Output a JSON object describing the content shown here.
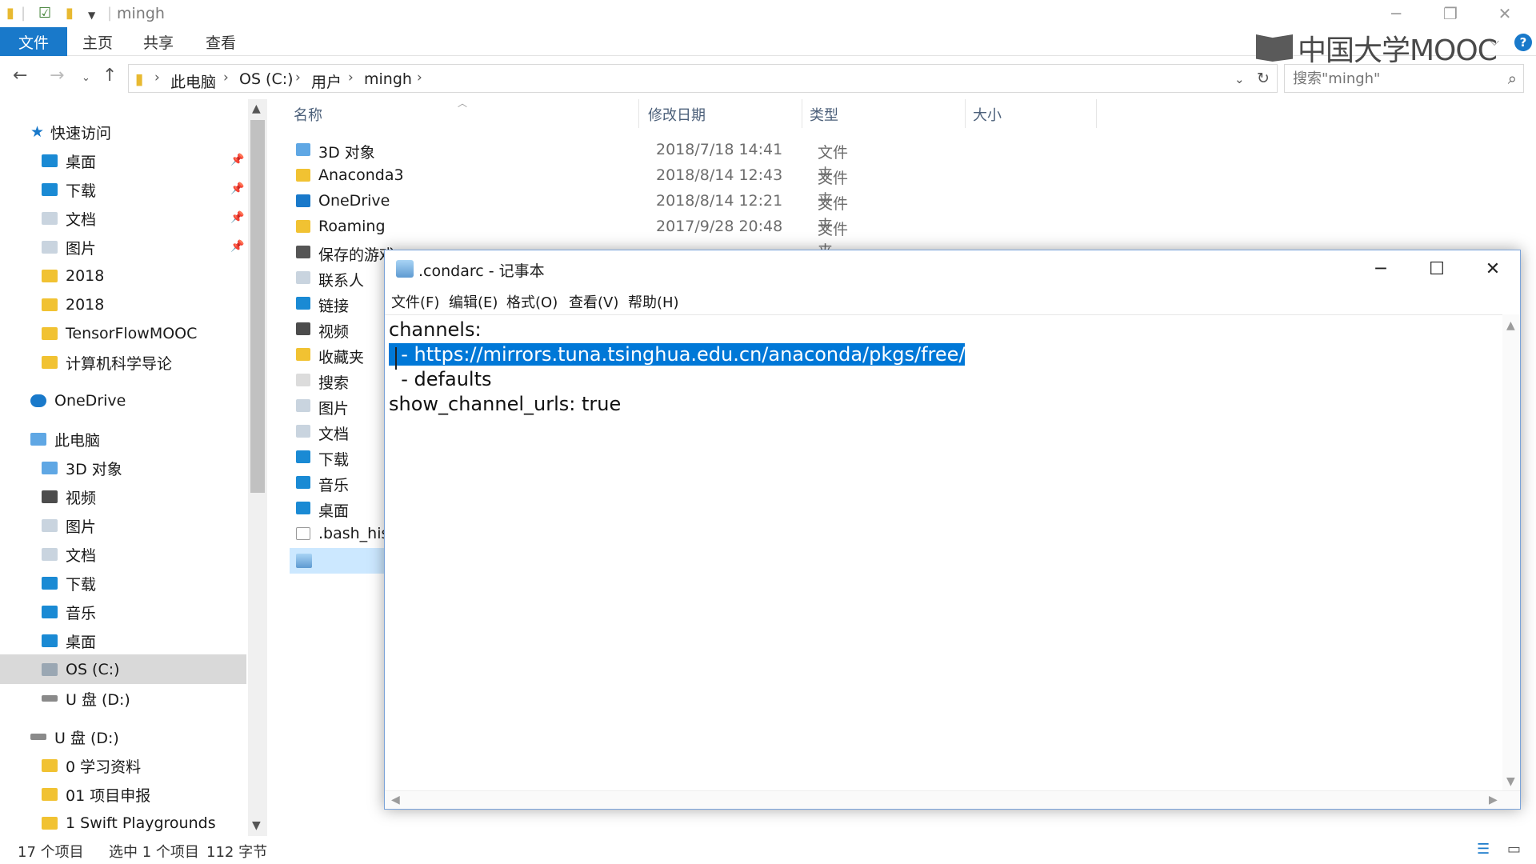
{
  "explorer": {
    "title": "mingh",
    "ribbon_tabs": [
      "文件",
      "主页",
      "共享",
      "查看"
    ],
    "logo_text": "中国大学MOOC",
    "address": [
      "此电脑",
      "OS (C:)",
      "用户",
      "mingh"
    ],
    "search_placeholder": "搜索\"mingh\"",
    "nav": {
      "quick_access": "快速访问",
      "pinned": [
        "桌面",
        "下载",
        "文档",
        "图片"
      ],
      "folders": [
        "2018",
        "2018",
        "TensorFlowMOOC",
        "计算机科学导论"
      ],
      "onedrive": "OneDrive",
      "this_pc": "此电脑",
      "pc_items": [
        "3D 对象",
        "视频",
        "图片",
        "文档",
        "下载",
        "音乐",
        "桌面",
        "OS (C:)",
        "U 盘 (D:)"
      ],
      "usb": "U 盘 (D:)",
      "usb_items": [
        "0 学习资料",
        "01 项目申报",
        "1 Swift Playgrounds"
      ]
    },
    "columns": [
      "名称",
      "修改日期",
      "类型",
      "大小"
    ],
    "files": [
      {
        "name": "3D 对象",
        "date": "2018/7/18 14:41",
        "type": "文件夹"
      },
      {
        "name": "Anaconda3",
        "date": "2018/8/14 12:43",
        "type": "文件夹"
      },
      {
        "name": "OneDrive",
        "date": "2018/8/14 12:21",
        "type": "文件夹"
      },
      {
        "name": "Roaming",
        "date": "2017/9/28 20:48",
        "type": "文件夹"
      },
      {
        "name": "保存的游戏",
        "date": "",
        "type": ""
      },
      {
        "name": "联系人",
        "date": "",
        "type": ""
      },
      {
        "name": "链接",
        "date": "",
        "type": ""
      },
      {
        "name": "视频",
        "date": "",
        "type": ""
      },
      {
        "name": "收藏夹",
        "date": "",
        "type": ""
      },
      {
        "name": "搜索",
        "date": "",
        "type": ""
      },
      {
        "name": "图片",
        "date": "",
        "type": ""
      },
      {
        "name": "文档",
        "date": "",
        "type": ""
      },
      {
        "name": "下载",
        "date": "",
        "type": ""
      },
      {
        "name": "音乐",
        "date": "",
        "type": ""
      },
      {
        "name": "桌面",
        "date": "",
        "type": ""
      },
      {
        "name": ".bash_hist",
        "date": "",
        "type": ""
      }
    ],
    "status": {
      "count": "17 个项目",
      "selected": "选中 1 个项目",
      "size": "112 字节"
    }
  },
  "notepad": {
    "title": ".condarc - 记事本",
    "menu": [
      "文件(F)",
      "编辑(E)",
      "格式(O)",
      "查看(V)",
      "帮助(H)"
    ],
    "lines": {
      "l1": "channels:",
      "l2_prefix": "  - ",
      "l2_selected": "https://mirrors.tuna.tsinghua.edu.cn/anaconda/pkgs/free/",
      "l3": "  - defaults",
      "l4": "show_channel_urls: true"
    }
  }
}
